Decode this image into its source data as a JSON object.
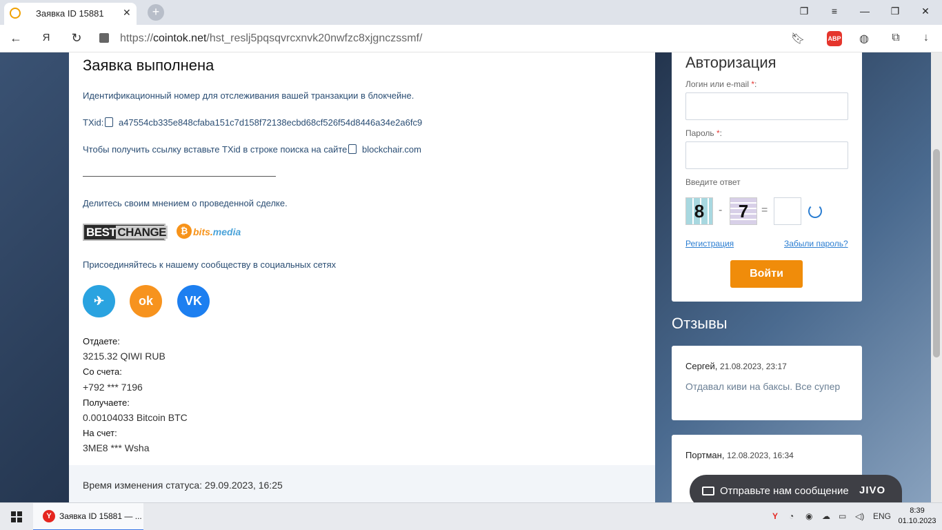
{
  "browser": {
    "tab_title": "Заявка ID 15881",
    "tab_close": "✕",
    "new_tab": "+",
    "url_prefix": "https://",
    "url_domain": "cointok.net",
    "url_path": "/hst_reslj5pqsqvrcxnvk20nwfzc8xjgnczssmf/",
    "abp_label": "ABP"
  },
  "main": {
    "title": "Заявка выполнена",
    "txid_intro": "Идентификационный номер для отслеживания вашей транзакции в блокчейне.",
    "txid_label": "TXid:",
    "txid_value": "a47554cb335e848cfaba151c7d158f72138ecbd68cf526f54d8446a34e2a6fc9",
    "link_hint": "Чтобы получить ссылку вставьте TXid в строке поиска на сайте",
    "link_site": "blockchair.com",
    "feedback_text": "Делитесь своим мнением о проведенной сделке.",
    "bestchange_best": "BEST",
    "bestchange_change": "CHANGE",
    "bits_icon": "₿",
    "bits_bits": "bits.",
    "bits_media": "media",
    "community_text": "Присоединяйтесь к нашему сообществу в социальных сетях",
    "social": [
      {
        "name": "telegram",
        "glyph": "✈",
        "color": "#2aa3e0"
      },
      {
        "name": "odnoklassniki",
        "glyph": "ok",
        "color": "#f7931e"
      },
      {
        "name": "vk",
        "glyph": "VK",
        "color": "#1d7ff0"
      }
    ],
    "give_label": "Отдаете:",
    "give_value": "3215.32 QIWI RUB",
    "from_label": "Со счета:",
    "from_value": "+792 *** 7196",
    "receive_label": "Получаете:",
    "receive_value": "0.00104033 Bitcoin BTC",
    "to_label": "На счет:",
    "to_value": "3ME8 *** Wsha",
    "status_time": "Время изменения статуса: 29.09.2023, 16:25"
  },
  "auth": {
    "title": "Авторизация",
    "login_label": "Логин или e-mail",
    "password_label": "Пароль",
    "required_mark": "*",
    "colon": ":",
    "captcha_label": "Введите ответ",
    "captcha_a": "8",
    "captcha_op": "-",
    "captcha_b": "7",
    "captcha_eq": "=",
    "register_link": "Регистрация",
    "forgot_link": "Забыли пароль?",
    "login_button": "Войти"
  },
  "reviews": {
    "title": "Отзывы",
    "items": [
      {
        "author": "Сергей",
        "date": "21.08.2023, 23:17",
        "text": "Отдавал киви на баксы. Все супер"
      },
      {
        "author": "Портман",
        "date": "12.08.2023, 16:34",
        "text": ""
      }
    ]
  },
  "chat": {
    "label": "Отправьте нам сообщение",
    "logo": "JIVO"
  },
  "taskbar": {
    "app_label": "Заявка ID 15881 — ...",
    "app_icon": "Y",
    "lang": "ENG",
    "time": "8:39",
    "date": "01.10.2023"
  }
}
